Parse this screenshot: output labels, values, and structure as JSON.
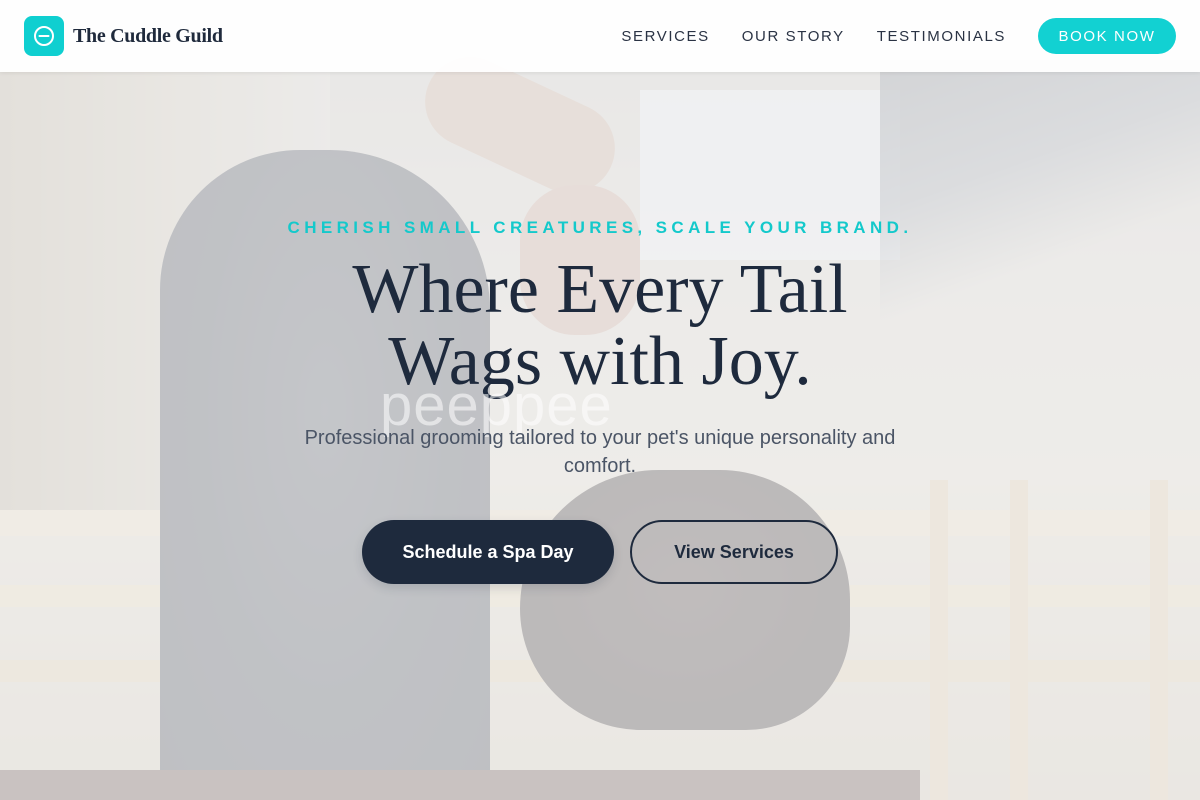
{
  "header": {
    "brand_name": "The Cuddle Guild",
    "logo_icon": "minus-circle-icon",
    "nav": [
      {
        "label": "SERVICES"
      },
      {
        "label": "OUR STORY"
      },
      {
        "label": "TESTIMONIALS"
      }
    ],
    "cta_label": "BOOK NOW"
  },
  "hero": {
    "eyebrow": "CHERISH SMALL CREATURES, SCALE YOUR BRAND.",
    "headline_line1": "Where Every Tail",
    "headline_line2": "Wags with Joy.",
    "watermark": "peeppee",
    "subheading": "Professional grooming tailored to your pet's unique personality and comfort.",
    "primary_cta": "Schedule a Spa Day",
    "secondary_cta": "View Services"
  },
  "colors": {
    "accent": "#12d1d2",
    "navy": "#1e2a3d",
    "text_muted": "#4b5566"
  }
}
